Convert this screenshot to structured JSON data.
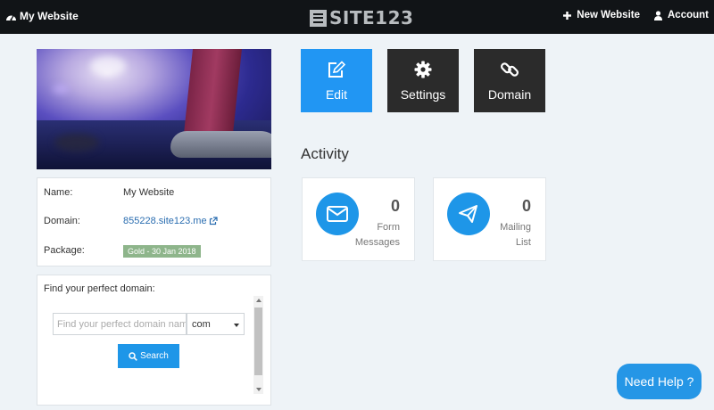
{
  "topbar": {
    "site_name": "My Website",
    "logo_text": "SITE123",
    "new_website_label": "New Website",
    "account_label": "Account"
  },
  "site_info": {
    "name_label": "Name:",
    "name_value": "My Website",
    "domain_label": "Domain:",
    "domain_value": "855228.site123.me",
    "package_label": "Package:",
    "package_value": "Gold - 30 Jan 2018"
  },
  "domain_finder": {
    "title": "Find your perfect domain:",
    "input_placeholder": "Find your perfect domain name",
    "tld_selected": "com",
    "search_label": "Search"
  },
  "actions": {
    "edit_label": "Edit",
    "settings_label": "Settings",
    "domain_label": "Domain"
  },
  "activity": {
    "heading": "Activity",
    "form_count": "0",
    "form_caption_line1": "Form",
    "form_caption_line2": "Messages",
    "mailing_count": "0",
    "mailing_caption_line1": "Mailing",
    "mailing_caption_line2": "List"
  },
  "help": {
    "label": "Need Help ?"
  },
  "colors": {
    "topbar_bg": "#111417",
    "accent": "#2196f3",
    "dark_tile": "#2b2b2b",
    "page_bg": "#eef3f7",
    "badge": "#8eb58b"
  },
  "icons": {
    "dashboard": "dashboard-icon",
    "plus": "plus-icon",
    "user": "user-icon",
    "edit": "edit-icon",
    "settings": "gear-icon",
    "domain": "link-icon",
    "external": "external-link-icon",
    "search": "search-icon",
    "envelope": "envelope-icon",
    "paper_plane": "paper-plane-icon"
  }
}
